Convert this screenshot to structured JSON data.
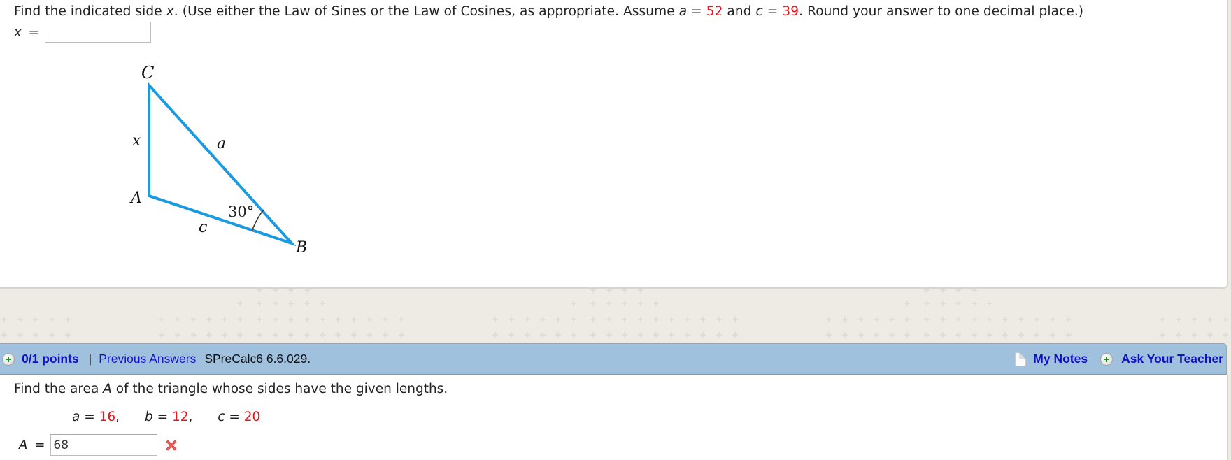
{
  "question1": {
    "prompt_parts": {
      "p1": "Find the indicated side ",
      "var_x": "x",
      "p2": ". (Use either the Law of Sines or the Law of Cosines, as appropriate. Assume ",
      "var_a": "a",
      "eq1": " = ",
      "a_value": "52",
      "p3": " and ",
      "var_c": "c",
      "eq2": " = ",
      "c_value": "39",
      "p4": ". Round your answer to one decimal place.)"
    },
    "answer_label": "x",
    "answer_eq": "=",
    "answer_value": "",
    "figure": {
      "vertex_labels": {
        "C": "C",
        "A": "A",
        "B": "B"
      },
      "side_labels": {
        "x": "x",
        "a": "a",
        "c": "c"
      },
      "angle_label": "30°",
      "line_color": "#1a9ae0"
    }
  },
  "question2_header": {
    "points": "0/1 points",
    "separator": "|",
    "previous_answers": "Previous Answers",
    "reference": "SPreCalc6 6.6.029.",
    "my_notes": "My Notes",
    "ask_teacher": "Ask Your Teacher",
    "bar_color": "#9fc1de",
    "icons": [
      "expand-plus-icon",
      "note-page-icon",
      "ask-teacher-plus-icon"
    ]
  },
  "question2": {
    "prompt_parts": {
      "p1": "Find the area ",
      "var_A": "A",
      "p2": " of the triangle whose sides have the given lengths."
    },
    "values": [
      {
        "var": "a",
        "eq": " = ",
        "value": "16",
        "suffix": ","
      },
      {
        "var": "b",
        "eq": " = ",
        "value": "12",
        "suffix": ","
      },
      {
        "var": "c",
        "eq": " = ",
        "value": "20",
        "suffix": ""
      }
    ],
    "answer_label": "A",
    "answer_eq": "=",
    "answer_value": "68",
    "status": "incorrect",
    "status_icon": "red-x-icon"
  },
  "colors": {
    "highlight_red": "#e8141a",
    "link_blue": "#1010c8",
    "background": "#eeebe5"
  }
}
